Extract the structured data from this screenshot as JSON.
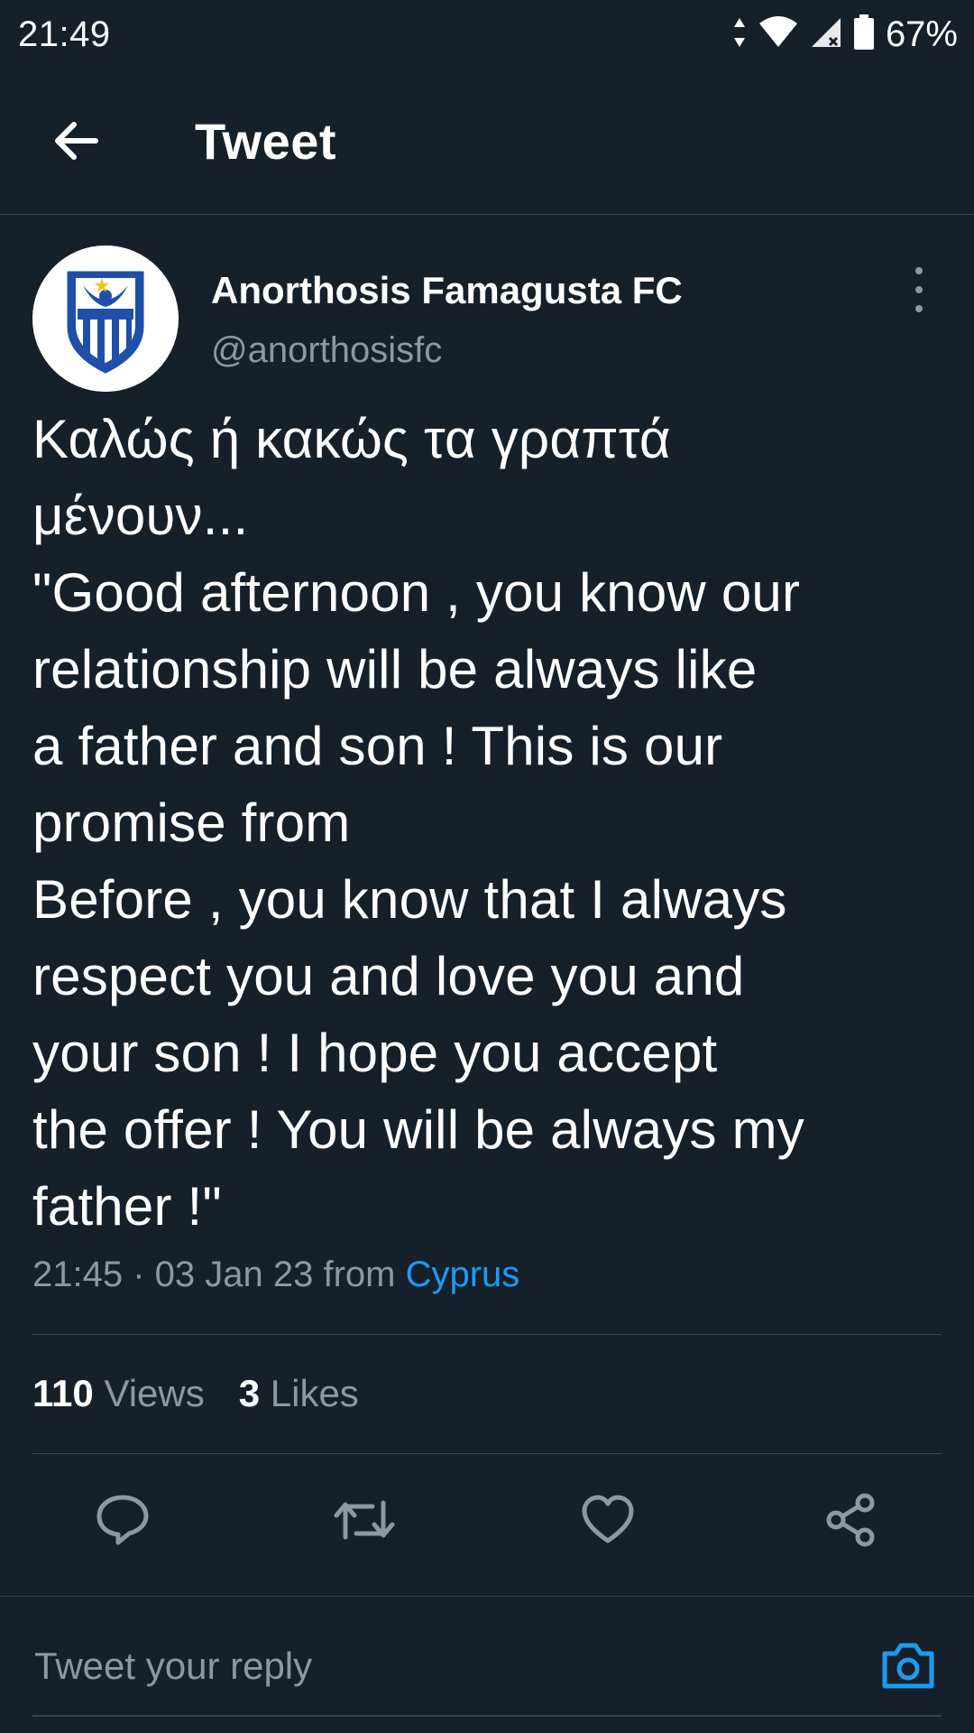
{
  "status_bar": {
    "time": "21:49",
    "battery": "67%",
    "icons": [
      "data-arrows-icon",
      "wifi-icon",
      "signal-icon",
      "battery-icon"
    ]
  },
  "header": {
    "title": "Tweet",
    "back_icon": "arrow-left-icon"
  },
  "tweet": {
    "author_name": "Anorthosis Famagusta FC",
    "author_handle": "@anorthosisfc",
    "avatar_icon": "club-crest-icon",
    "body": "Καλώς ή κακώς τα γραπτά\nμένουν...\n\"Good afternoon , you know our\nrelationship will be always like\na father and son ! This is our\npromise from\nBefore , you know that I always\nrespect you and love you and\nyour son ! I hope you accept\nthe offer ! You will be always my\nfather !\"",
    "timestamp": "21:45 · 03 Jan 23 from ",
    "location": "Cyprus"
  },
  "stats": {
    "views_count": "110",
    "views_label": "Views",
    "likes_count": "3",
    "likes_label": "Likes"
  },
  "actions": {
    "icons": [
      "reply-icon",
      "retweet-icon",
      "like-icon",
      "share-icon"
    ]
  },
  "reply": {
    "placeholder": "Tweet your reply",
    "camera_icon": "camera-icon"
  },
  "colors": {
    "background": "#15202b",
    "text_primary": "#ffffff",
    "text_secondary": "#8b98a5",
    "accent": "#1d9bf0",
    "divider": "#38444d"
  }
}
